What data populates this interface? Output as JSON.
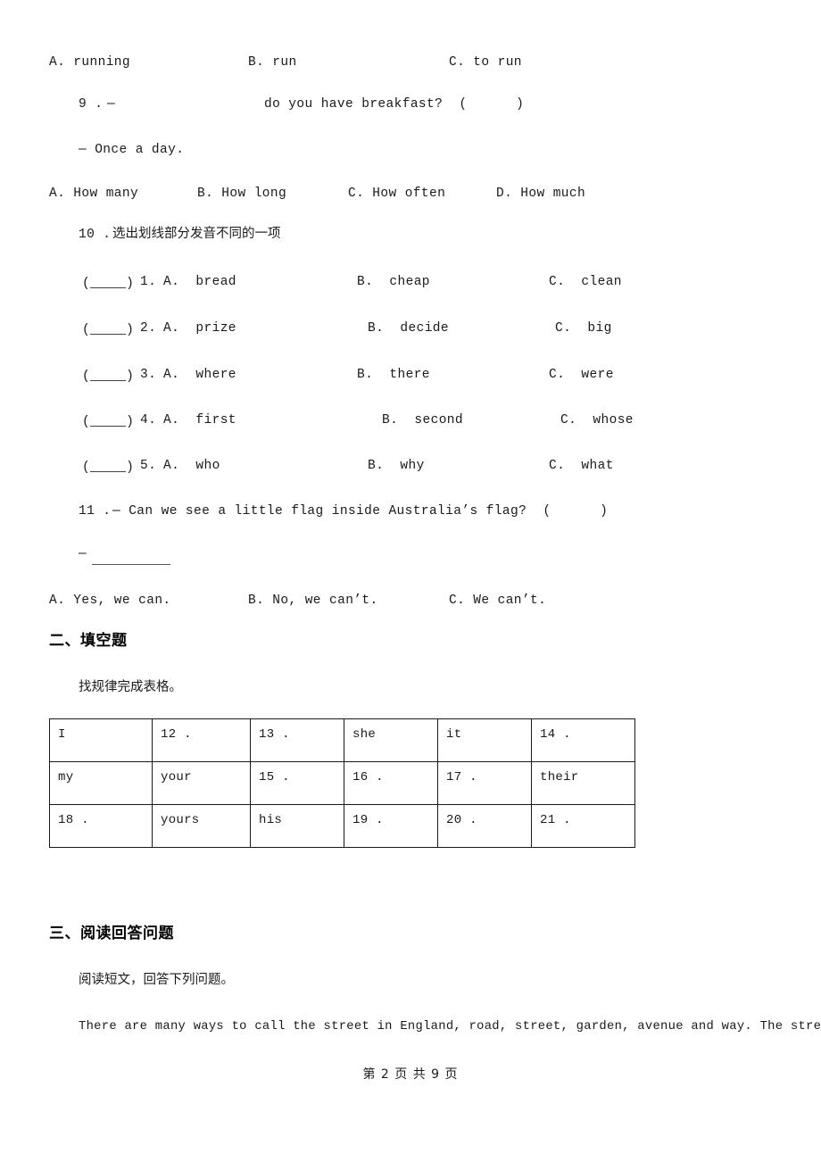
{
  "document": {
    "type": "exam-paper",
    "page_footer": "第 2 页 共 9 页"
  },
  "question_8_options": {
    "a": "A. running",
    "b": "B. run",
    "c": "C. to run"
  },
  "question_9": {
    "number": "9 .",
    "dash": "—",
    "stem_tail": "do you have breakfast?  (      )",
    "answer_line": "— Once a day.",
    "options": {
      "a": "A. How many",
      "b": "B. How long",
      "c": "C. How often",
      "d": "D. How much"
    }
  },
  "question_10": {
    "number": "10 .",
    "prompt": "选出划线部分发音不同的一项",
    "items": [
      {
        "paren_open": "(",
        "paren_close": ")",
        "index": "1.",
        "a": "A.  bread",
        "b": "B.  cheap",
        "c": "C.  clean"
      },
      {
        "paren_open": "(",
        "paren_close": ")",
        "index": "2.",
        "a": "A.  prize",
        "b": "B.  decide",
        "c": "C.  big"
      },
      {
        "paren_open": "(",
        "paren_close": ")",
        "index": "3.",
        "a": "A.  where",
        "b": "B.  there",
        "c": "C.  were"
      },
      {
        "paren_open": "(",
        "paren_close": ")",
        "index": "4.",
        "a": "A.  first",
        "b": "B.  second",
        "c": "C.  whose"
      },
      {
        "paren_open": "(",
        "paren_close": ")",
        "index": "5.",
        "a": "A.  who",
        "b": "B.  why",
        "c": "C.  what"
      }
    ]
  },
  "question_11": {
    "number": "11 .",
    "stem": "— Can we see a little flag inside Australia’s flag?  (      )",
    "answer_dash": "—",
    "options": {
      "a": "A. Yes, we can.",
      "b": "B. No, we can’t.",
      "c": "C. We can’t."
    }
  },
  "section_two": {
    "heading": "二、填空题",
    "instruction": "找规律完成表格。",
    "table": {
      "rows": [
        [
          "I",
          "12 .",
          "13 .",
          "she",
          "it",
          "14 ."
        ],
        [
          "my",
          "your",
          "15 .",
          "16 .",
          "17 .",
          "their"
        ],
        [
          "18 .",
          "yours",
          "his",
          "19 .",
          "20 .",
          "21 ."
        ]
      ]
    }
  },
  "section_three": {
    "heading": "三、阅读回答问题",
    "instruction": "阅读短文，回答下列问题。",
    "passage_line_1": "There are many ways to call the street in England, road, street, garden, avenue and way. The streets"
  }
}
